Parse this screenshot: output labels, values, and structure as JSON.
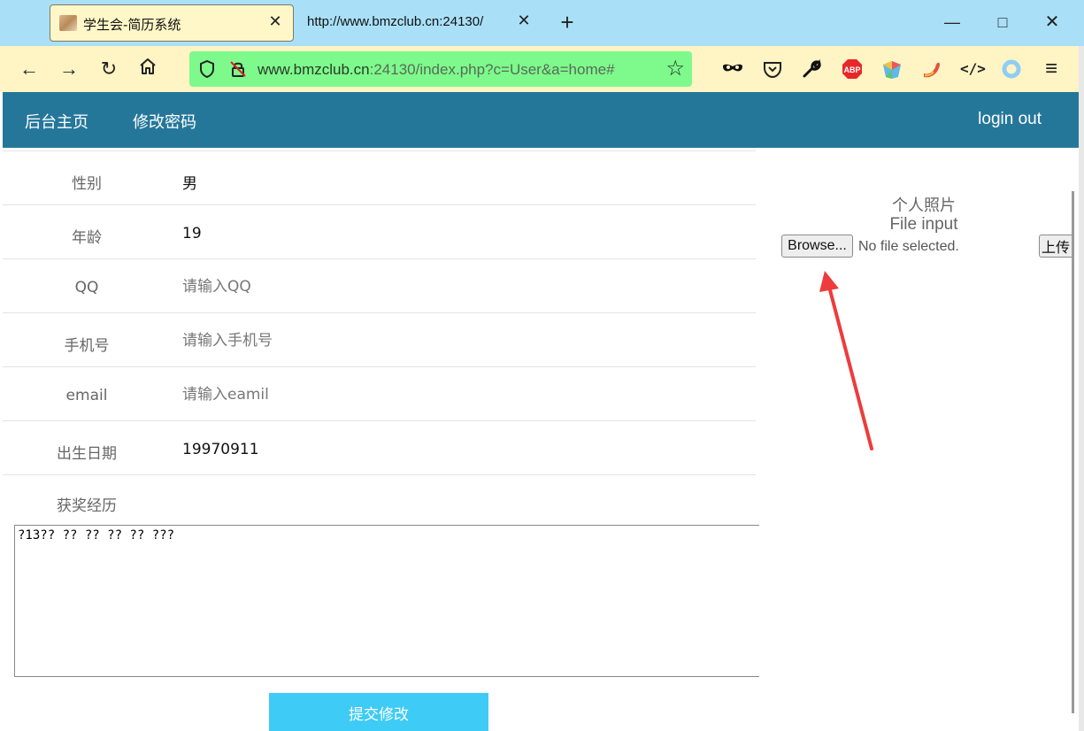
{
  "browser": {
    "tabs": [
      {
        "title": "学生会-简历系统",
        "active": true
      },
      {
        "title": "http://www.bmzclub.cn:24130/",
        "active": false
      }
    ],
    "url_host": "www.bmzclub.cn",
    "url_rest": ":24130/index.php?c=User&a=home#",
    "icons": {
      "back": "←",
      "forward": "→",
      "reload": "↻",
      "home": "home-icon",
      "new_tab": "+",
      "minimize": "—",
      "maximize": "□",
      "close": "✕",
      "tab_close": "✕",
      "star": "☆",
      "menu": "≡",
      "devtools": "</>"
    },
    "extensions": [
      "mask-icon",
      "pocket-icon",
      "wrench-icon",
      "adblock-icon",
      "colorful-extension-icon",
      "gummy-extension-icon",
      "code-icon",
      "ring-icon",
      "menu-icon"
    ],
    "adblock_text": "ABP"
  },
  "header": {
    "home_label": "后台主页",
    "password_label": "修改密码",
    "logout_label": "login out",
    "bg_color": "#25779a"
  },
  "form": {
    "rows": [
      {
        "label": "性别",
        "value": "男",
        "type": "text"
      },
      {
        "label": "年龄",
        "value": "19",
        "type": "text"
      },
      {
        "label": "QQ",
        "placeholder": "请输入QQ",
        "type": "input"
      },
      {
        "label": "手机号",
        "placeholder": "请输入手机号",
        "type": "input"
      },
      {
        "label": "email",
        "placeholder": "请输入eamil",
        "type": "input"
      },
      {
        "label": "出生日期",
        "value": "19970911",
        "type": "text"
      }
    ],
    "award_label": "获奖经历",
    "award_value": "?13?? ?? ?? ?? ?? ???",
    "submit_label": "提交修改",
    "submit_color": "#3ecbf6"
  },
  "photo": {
    "title": "个人照片",
    "file_label": "File input",
    "browse_label": "Browse...",
    "file_status": "No file selected.",
    "upload_label": "上传"
  }
}
